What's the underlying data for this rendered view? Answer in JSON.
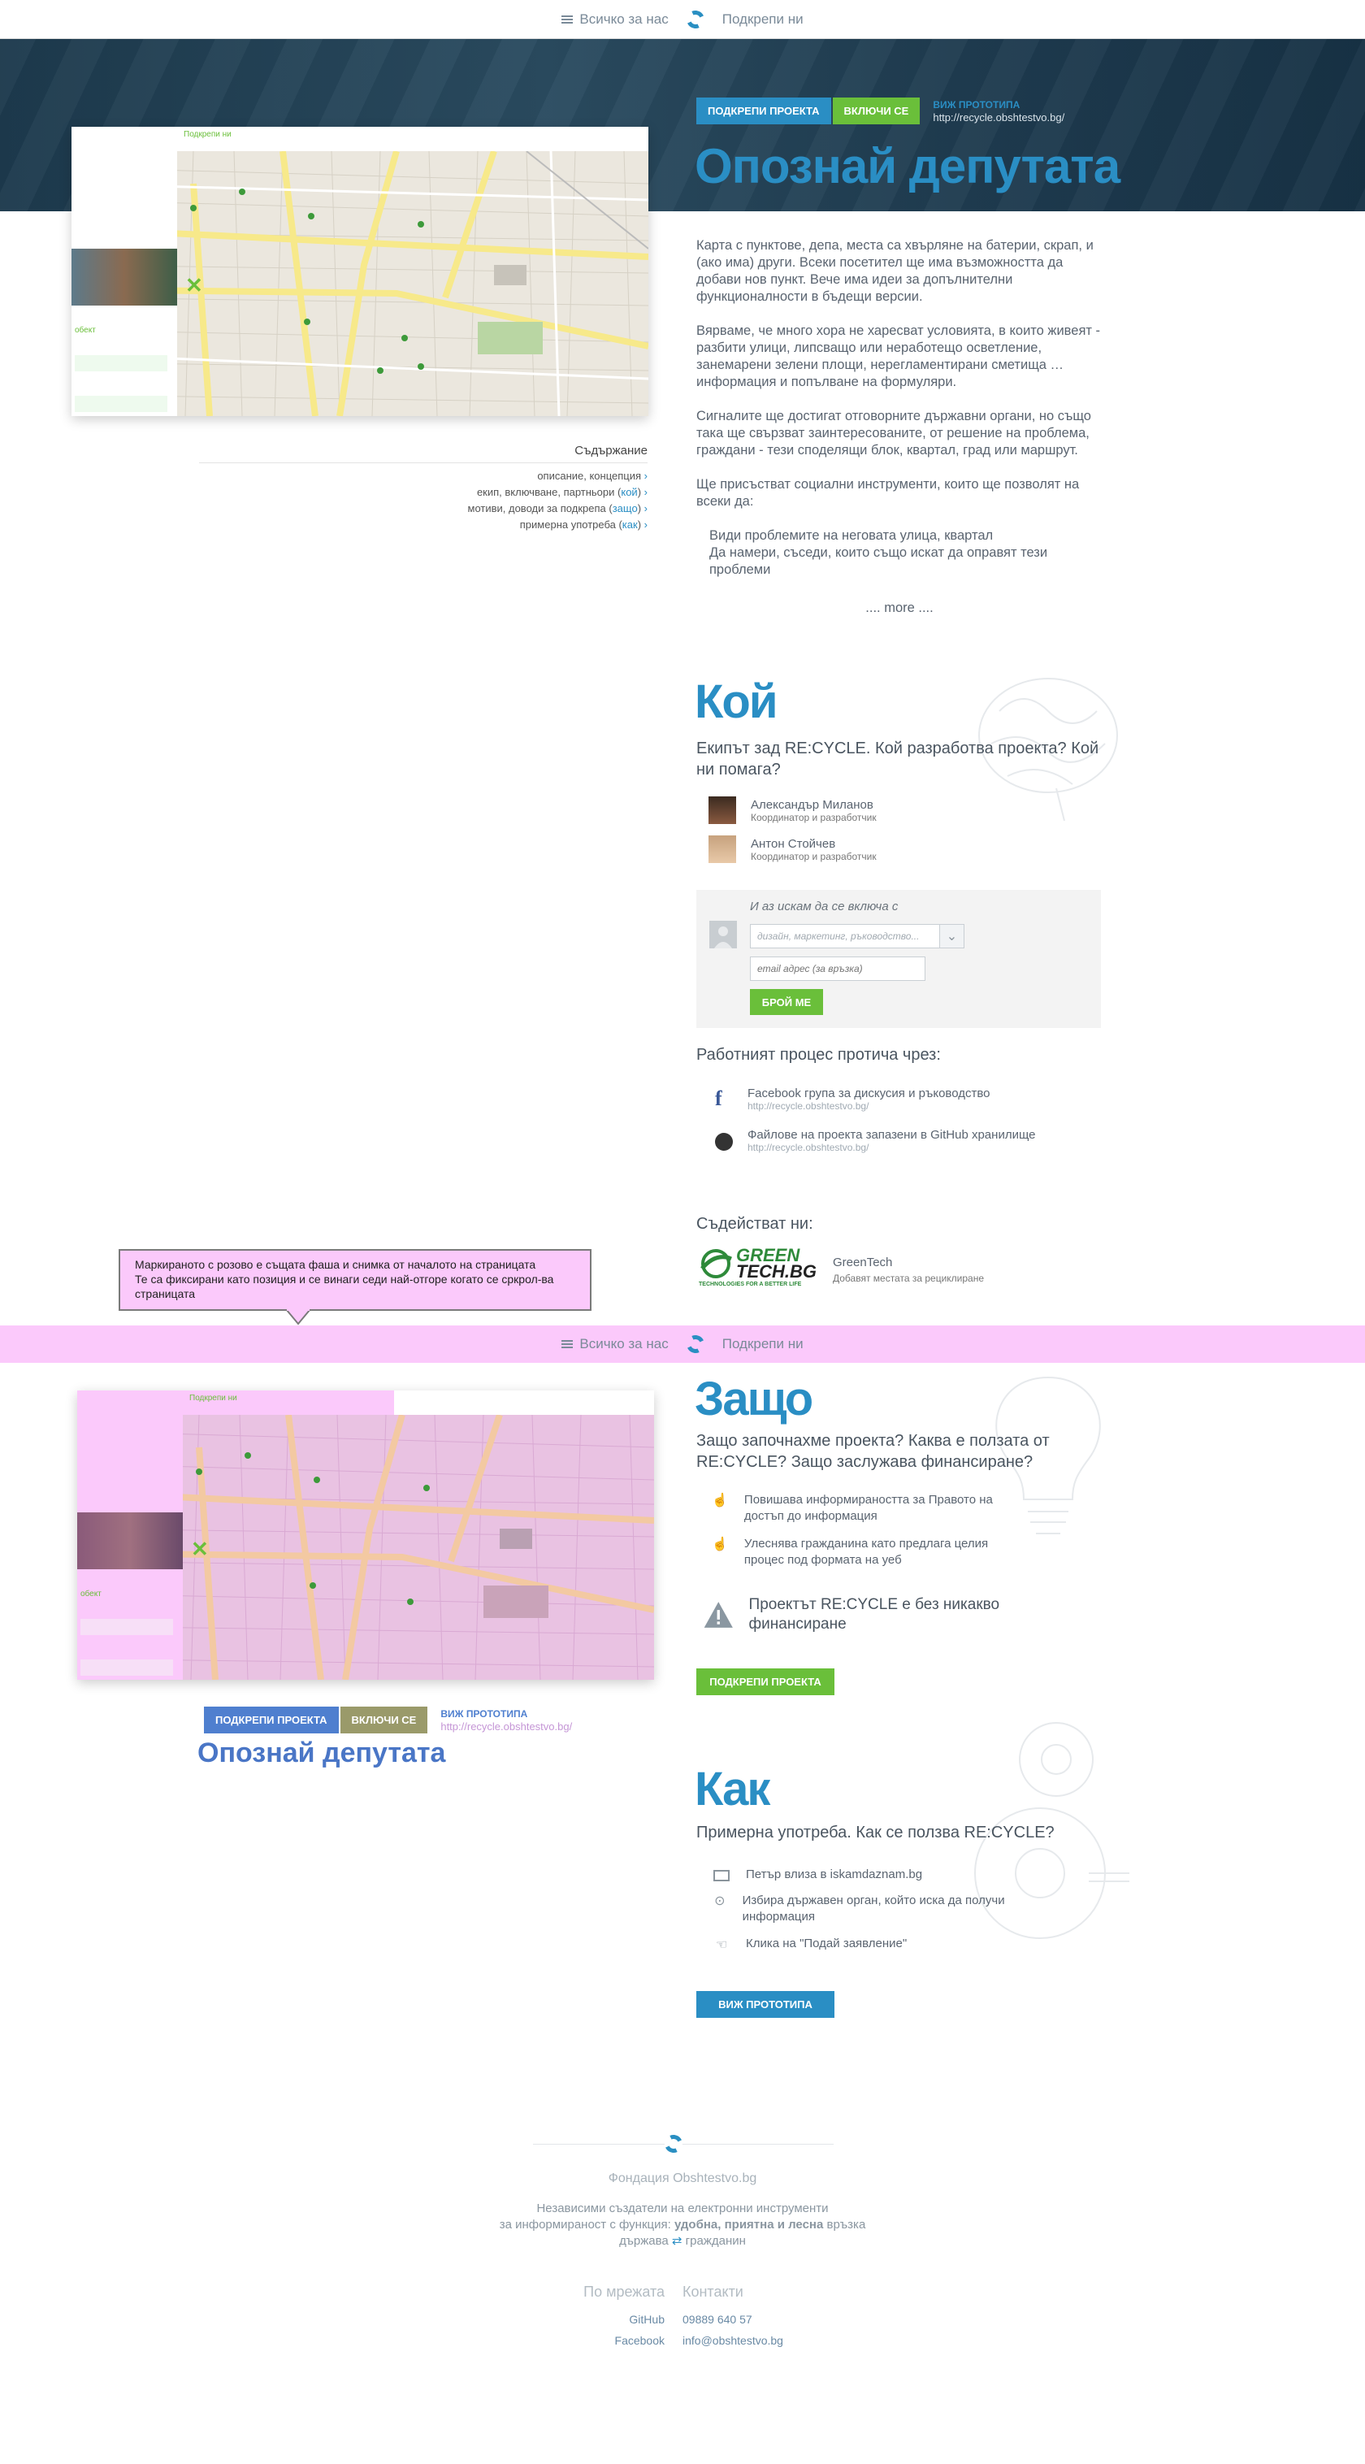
{
  "topnav": {
    "about": "Всичко за нас",
    "support": "Подкрепи ни"
  },
  "hero": {
    "btn_support": "ПОДКРЕПИ ПРОЕКТА",
    "btn_join": "ВКЛЮЧИ СЕ",
    "prototype_label": "ВИЖ ПРОТОТИПА",
    "prototype_url": "http://recycle.obshtestvo.bg/",
    "title": "Опознай депутата"
  },
  "map": {
    "support_link": "Подкрепи ни",
    "side_label": "обект"
  },
  "description": {
    "p1": "Карта с пунктове, депа, места са хвърляне на батерии, скрап, и (ако има) други. Всеки посетител ще има възможността да добави нов пункт. Вече има идеи за допълнителни функционалности в бъдещи версии.",
    "p2": "Вярваме, че много хора не харесват условията, в които живеят - разбити улици, липсващо или неработещо осветление, занемарени зелени площи, нерегламентирани сметища … информация и попълване на формуляри.",
    "p3": "Сигналите ще достигат отговорните държавни органи, но също така ще свързват заинтересованите, от решение на проблема, граждани - тези споделящи блок, квартал, град или маршрут.",
    "p4": "Ще присъстват социални инструменти, които ще позволят на всеки да:",
    "li1": "Види проблемите на неговата улица, квартал",
    "li2": "Да намери, съседи, които също искат да оправят тези проблеми",
    "more": ".... more ...."
  },
  "toc": {
    "title": "Съдържание",
    "items": [
      {
        "text": "описание, концепция",
        "key": ""
      },
      {
        "text": "екип, включване, партньори (",
        "key": "кой",
        "end": ")"
      },
      {
        "text": "мотиви, доводи за подкрепа (",
        "key": "защо",
        "end": ")"
      },
      {
        "text": "примерна употреба (",
        "key": "как",
        "end": ")"
      }
    ]
  },
  "who": {
    "title": "Кой",
    "subtitle": "Екипът зад RE:CYCLE. Кой разработва проекта? Кой ни помага?",
    "people": [
      {
        "name": "Александър Миланов",
        "role": "Координатор и разработчик"
      },
      {
        "name": "Антон Стойчев",
        "role": "Координатор и разработчик"
      }
    ],
    "join_title": "И аз искам да се включа с",
    "select_placeholder": "дизайн, маркетинг, ръководство...",
    "email_placeholder": "email адрес (за връзка)",
    "join_button": "БРОЙ МЕ",
    "process_title": "Работният процес протича чрез:",
    "process": [
      {
        "text": "Facebook група за дискусия и ръководство",
        "url": "http://recycle.obshtestvo.bg/"
      },
      {
        "text": "Файлове на проекта запазени в GitHub хранилище",
        "url": "http://recycle.obshtestvo.bg/"
      }
    ],
    "partners_title": "Съдействат ни:",
    "partner": {
      "logo_line1": "GREEN",
      "logo_line2": "TECH.BG",
      "logo_tagline": "TECHNOLOGIES FOR A BETTER LIFE",
      "name": "GreenTech",
      "desc": "Добавят местата за рециклиране"
    }
  },
  "callout": {
    "line1": "Маркираното с розово е същата фаша и снимка от началото на страницата",
    "line2": "Те са фиксирани като позиция и се винаги седи най-отгоре когато се сркрол-ва страницата"
  },
  "why": {
    "title": "Защо",
    "subtitle": "Защо започнахме проекта? Каква е ползата от RE:CYCLE? Защо заслужава финансиране?",
    "points": [
      "Повишава информираността за Правото на достъп до информация",
      "Улеснява гражданина като предлага целия процес под формата на уеб"
    ],
    "warning": "Проектът RE:CYCLE е без  никакво финансиране",
    "button": "ПОДКРЕПИ ПРОЕКТА"
  },
  "how": {
    "title": "Как",
    "subtitle": "Примерна употреба.  Как се ползва RE:CYCLE?",
    "steps": [
      "Петър влиза в iskamdaznam.bg",
      "Избира държавен орган, който иска да получи информация",
      "Клика на \"Подай заявление\""
    ],
    "button": "ВИЖ ПРОТОТИПА"
  },
  "footer": {
    "org": "Фондация Obshtestvo.bg",
    "line1": "Независими създатели на електронни инструменти",
    "line2a": "за информираност с функция: ",
    "line2b": "удобна, приятна и лесна",
    "line2c": " връзка",
    "line3a": "държава",
    "line3b": "гражданин",
    "col1_title": "По мрежата",
    "col2_title": "Контакти",
    "col1": [
      "GitHub",
      "Facebook"
    ],
    "col2": [
      "09889 640 57",
      "info@obshtestvo.bg"
    ]
  }
}
